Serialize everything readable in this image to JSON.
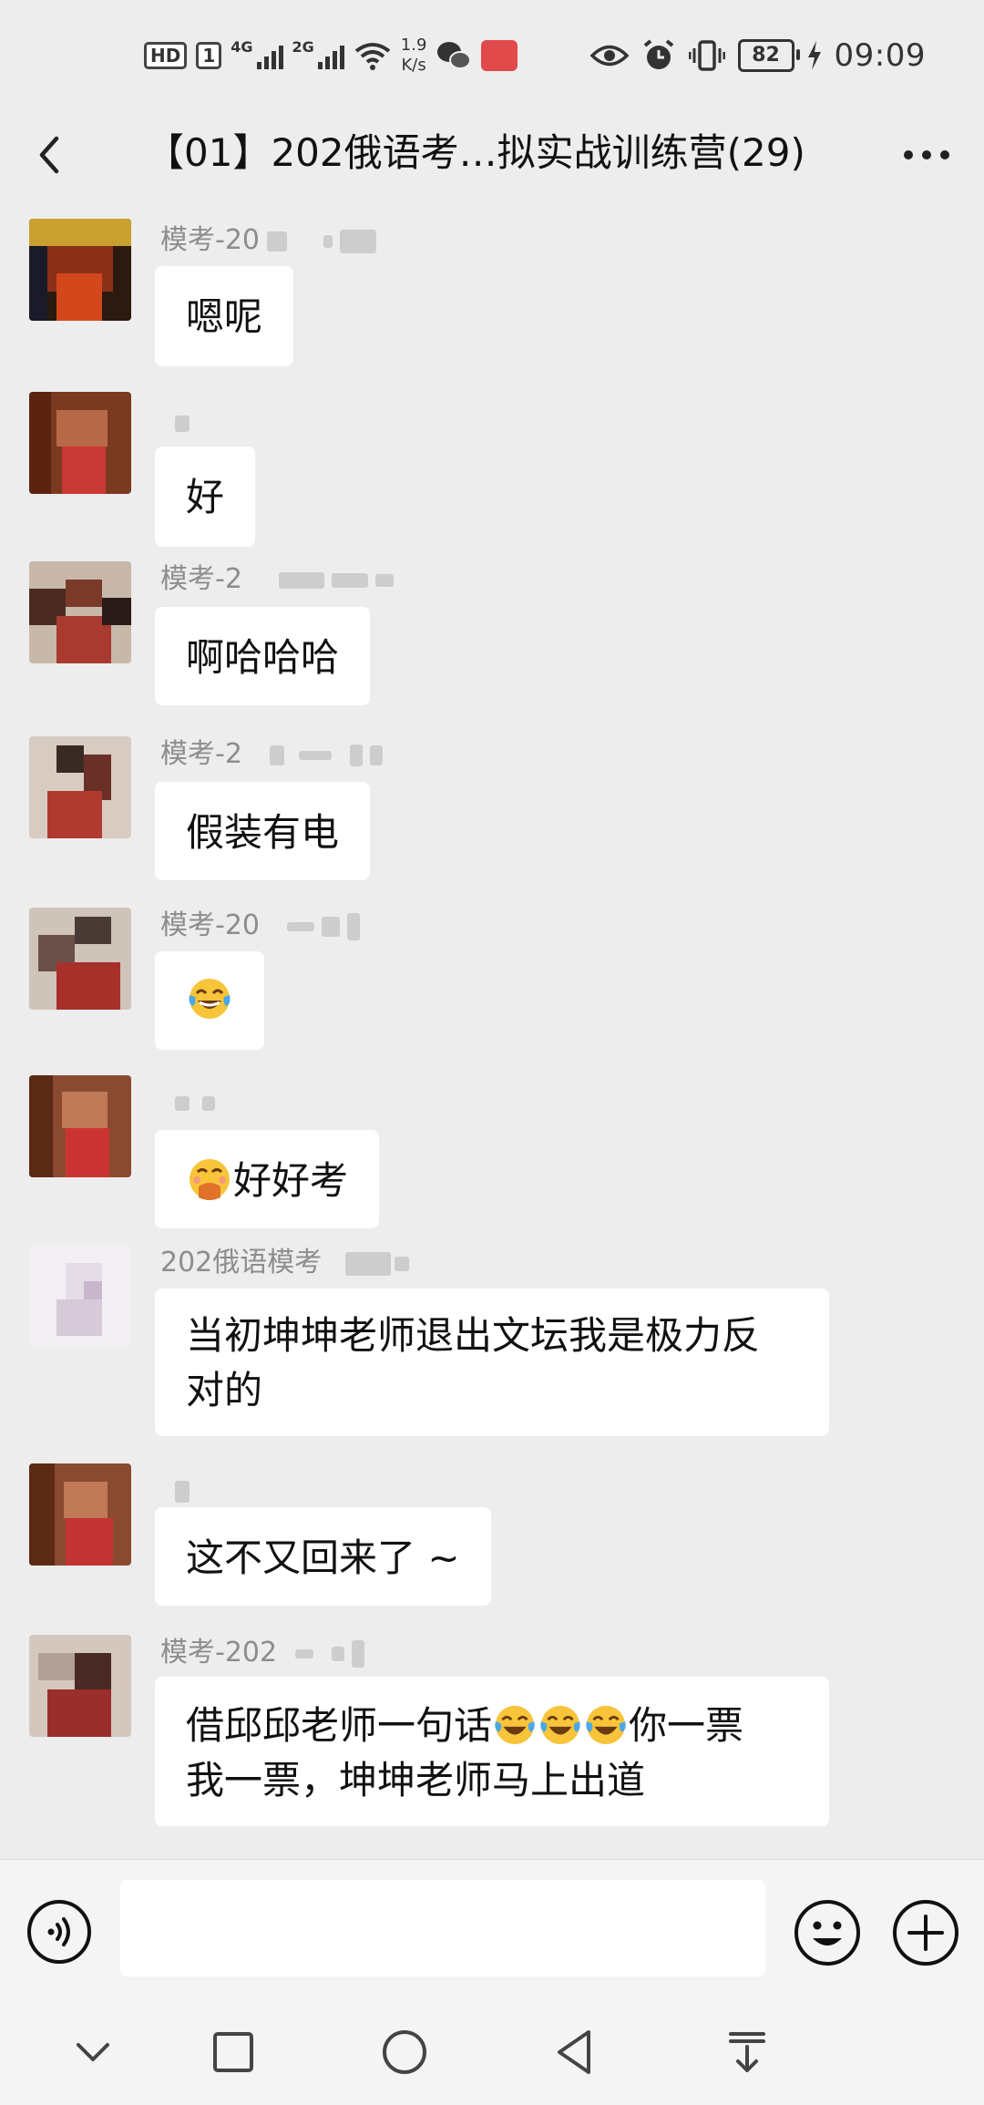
{
  "status_bar": {
    "hd_label": "HD",
    "sim1_label": "1",
    "net1_label": "4G",
    "net2_label": "2G",
    "speed_value": "1.9",
    "speed_unit": "K/s",
    "battery_level": "82",
    "time": "09:09",
    "icons": [
      "hd-icon",
      "signal-4g-icon",
      "signal-2g-icon",
      "wifi-icon",
      "wechat-icon",
      "app-icon",
      "eye-icon",
      "alarm-icon",
      "vibrate-icon",
      "battery-icon",
      "charging-icon"
    ]
  },
  "header": {
    "title": "【01】202俄语考…拟实战训练营(29)",
    "back_icon": "chevron-left-icon",
    "more_icon": "more-dots-icon"
  },
  "messages": [
    {
      "sender": "模考-20",
      "text": "嗯呢"
    },
    {
      "sender": "",
      "text": "好"
    },
    {
      "sender": "模考-2",
      "text": "啊哈哈哈"
    },
    {
      "sender": "模考-2",
      "text": "假装有电"
    },
    {
      "sender": "模考-20",
      "emoji": "tears-of-joy-emoji"
    },
    {
      "sender": "",
      "emoji": "hand-over-mouth-emoji",
      "text": "好好考"
    },
    {
      "sender": "202俄语模考",
      "text_line1": "当初坤坤老师退出文坛我是极力反",
      "text_line2": "对的"
    },
    {
      "sender": "",
      "text": "这不又回来了 ~"
    },
    {
      "sender": "模考-202",
      "text_line1_a": "借邱邱老师一句话",
      "text_line1_b": "你一票",
      "text_line2": "我一票，坤坤老师马上出道",
      "emoji": "tears-of-joy-emoji"
    }
  ],
  "input_bar": {
    "placeholder": "",
    "value": "",
    "voice_icon": "voice-icon",
    "emoji_icon": "smiley-icon",
    "plus_icon": "plus-icon"
  },
  "nav_bar": {
    "icons": [
      "chevron-down-icon",
      "square-icon",
      "circle-icon",
      "triangle-back-icon",
      "notification-pull-icon"
    ]
  }
}
